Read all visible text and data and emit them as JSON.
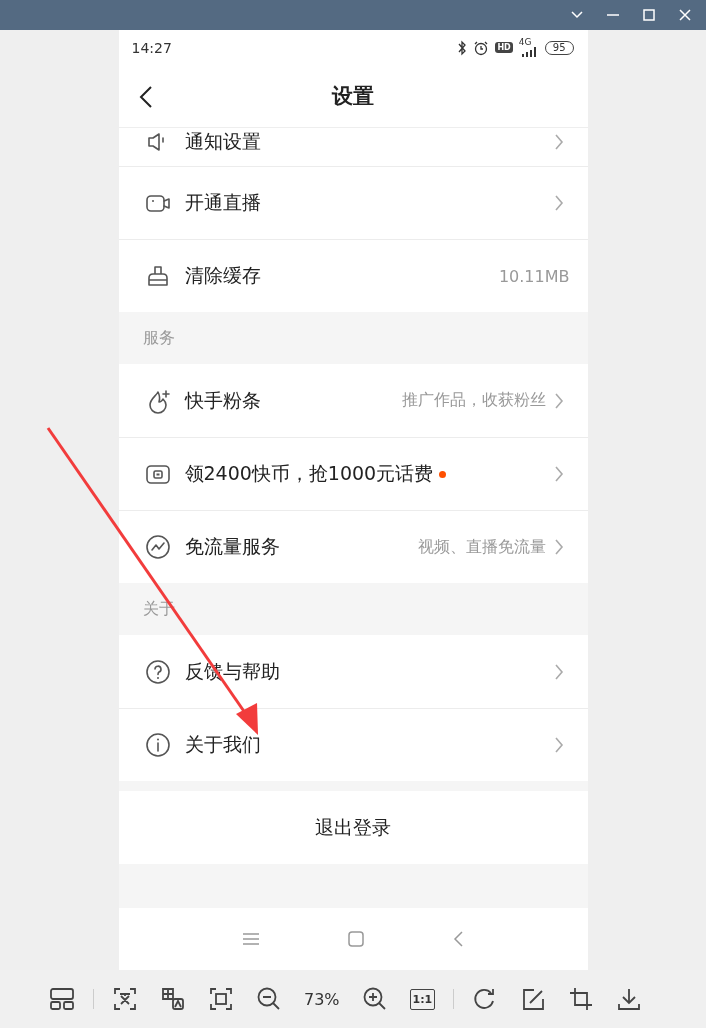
{
  "status_bar": {
    "time": "14:27",
    "hd": "HD",
    "network": "4G",
    "battery": "95"
  },
  "header": {
    "title": "设置"
  },
  "sections": [
    {
      "items": [
        {
          "label": "通知设置",
          "chevron": true,
          "partial": true
        },
        {
          "label": "开通直播",
          "chevron": true
        },
        {
          "label": "清除缓存",
          "value": "10.11MB",
          "chevron": false
        }
      ]
    },
    {
      "title": "服务",
      "items": [
        {
          "label": "快手粉条",
          "value": "推广作品，收获粉丝",
          "chevron": true
        },
        {
          "label": "领2400快币，抢1000元话费",
          "unread": true,
          "chevron": true
        },
        {
          "label": "免流量服务",
          "value": "视频、直播免流量",
          "chevron": true
        }
      ]
    },
    {
      "title": "关于",
      "items": [
        {
          "label": "反馈与帮助",
          "chevron": true
        },
        {
          "label": "关于我们",
          "chevron": true
        }
      ]
    }
  ],
  "logout": {
    "label": "退出登录"
  },
  "toolbar": {
    "zoom": "73%",
    "actual_size": "1:1"
  },
  "annotations": [
    {
      "kind": "arrow"
    }
  ]
}
